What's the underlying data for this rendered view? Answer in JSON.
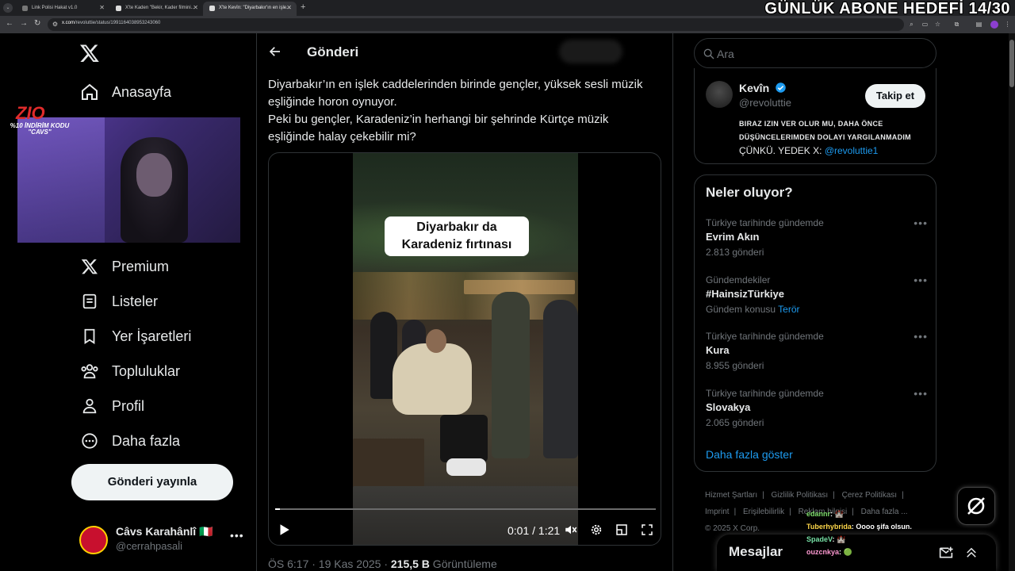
{
  "browser": {
    "tabs": [
      {
        "title": "Link Polisi Hakat v1.0"
      },
      {
        "title": "X'te Kaden \"Bekir, Kader filmini..."
      },
      {
        "title": "X'te Kevîn: \"Diyarbakır'ın en işle..."
      }
    ],
    "new_tab": "+",
    "url_host": "x.com",
    "url_path": "/revoluttie/status/1991164038953243060"
  },
  "overlay": {
    "subscriber_goal": "GÜNLÜK ABONE HEDEFİ 14/30",
    "brand": "ZIO",
    "promo": "%10 İNDİRİM KODU \"CAVS\""
  },
  "sidebar": {
    "items": [
      {
        "label": "Anasayfa",
        "icon": "home-icon"
      },
      {
        "label": "Premium",
        "icon": "x-premium-icon"
      },
      {
        "label": "Listeler",
        "icon": "list-icon"
      },
      {
        "label": "Yer İşaretleri",
        "icon": "bookmark-icon"
      },
      {
        "label": "Topluluklar",
        "icon": "communities-icon"
      },
      {
        "label": "Profil",
        "icon": "profile-icon"
      },
      {
        "label": "Daha fazla",
        "icon": "more-circle-icon"
      }
    ],
    "post_button": "Gönderi yayınla",
    "account": {
      "name": "Câvs Karahânlî 🇮🇹",
      "handle": "@cerrahpasal̇i",
      "more": "•••"
    }
  },
  "main": {
    "title": "Gönderi",
    "tweet_lines": [
      "Diyarbakır’ın en işlek caddelerinden birinde gençler, yüksek sesli müzik",
      "eşliğinde horon oynuyor.",
      "Peki bu gençler, Karadeniz’in herhangi bir şehrinde Kürtçe müzik",
      "eşliğinde halay çekebilir mi?"
    ],
    "video": {
      "caption_line1": "Diyarbakır da",
      "caption_line2": "Karadeniz fırtınası",
      "time": "0:01 / 1:21",
      "progress": 0.012
    },
    "meta_time": "ÖS 6:17 · 19 Kas 2025 · ",
    "meta_views": "215,5 B",
    "meta_views_label": " Görüntüleme"
  },
  "right": {
    "search_placeholder": "Ara",
    "profile": {
      "name": "Kevîn",
      "handle": "@revoluttie",
      "follow": "Takip et",
      "bio_line1": "BIRAZ IZIN VER OLUR MU, DAHA ÖNCE",
      "bio_line2": "DÜŞÜNCELERIMDEN DOLAYI YARGILANMADIM",
      "bio_line3": "ÇÜNKÜ. YEDEK X: ",
      "bio_link": "@revoluttie1"
    },
    "trends_title": "Neler oluyor?",
    "trends": [
      {
        "context": "Türkiye tarihinde gündemde",
        "name": "Evrim Akın",
        "count": "2.813 gönderi",
        "link": ""
      },
      {
        "context": "Gündemdekiler",
        "name": "#HainsizTürkiye",
        "count": "Gündem konusu ",
        "link": "Terör"
      },
      {
        "context": "Türkiye tarihinde gündemde",
        "name": "Kura",
        "count": "8.955 gönderi",
        "link": ""
      },
      {
        "context": "Türkiye tarihinde gündemde",
        "name": "Slovakya",
        "count": "2.065 gönderi",
        "link": ""
      }
    ],
    "show_more": "Daha fazla göster",
    "footer": [
      "Hizmet Şartları",
      "|",
      "Gizlilik Politikası",
      "|",
      "Çerez Politikası",
      "|",
      "Imprint",
      "|",
      "Erişilebilirlik",
      "|",
      "Reklam bilgisi",
      "|",
      "Daha fazla ...",
      "© 2025 X Corp."
    ],
    "messages_title": "Mesajlar"
  },
  "chat": [
    {
      "user": "edannr",
      "text": ": 🏰"
    },
    {
      "user": "Tuberhybrida",
      "text": ": Oooo şifa olsun."
    },
    {
      "user": "SpadeV",
      "text": ": 🏰"
    },
    {
      "user": "ouzcnkya",
      "text": ": 🟢"
    }
  ],
  "colors": {
    "background": "#000000",
    "text": "#e7e9ea",
    "muted": "#71767b",
    "accent": "#1d9bf0",
    "border": "#2f3336"
  }
}
